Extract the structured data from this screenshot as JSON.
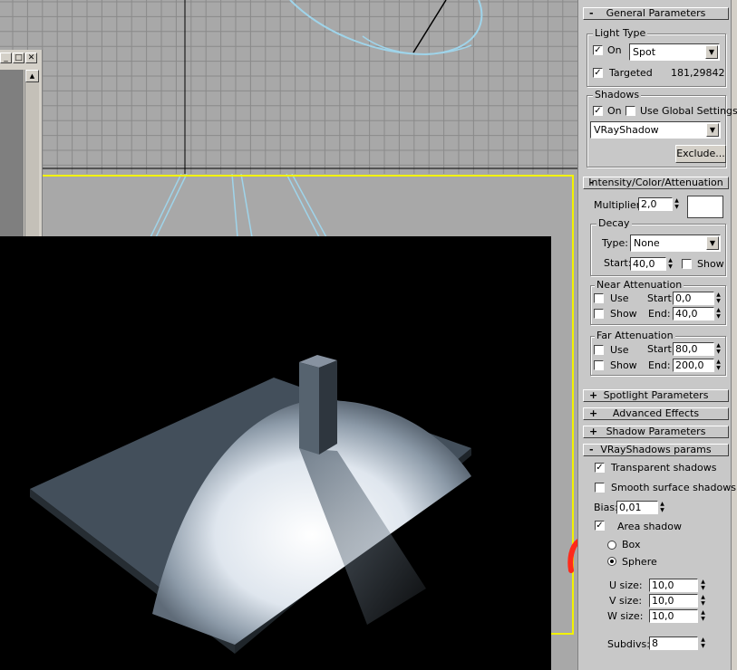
{
  "general": {
    "title": "General Parameters",
    "light_type_group": "Light Type",
    "on_label": "On",
    "on_checked": true,
    "type_value": "Spot",
    "targeted_label": "Targeted",
    "targeted_checked": true,
    "target_distance": "181,29842",
    "shadows_group": "Shadows",
    "shadows_on_label": "On",
    "use_global_label": "Use Global Settings",
    "shadow_type_value": "VRayShadow",
    "exclude_label": "Exclude..."
  },
  "intensity": {
    "title": "Intensity/Color/Attenuation",
    "multiplier_label": "Multiplier:",
    "multiplier_value": "2,0",
    "color": "#ffffff",
    "decay_group": "Decay",
    "type_label": "Type:",
    "type_value": "None",
    "start_label": "Start:",
    "start_value": "40,0",
    "show_label": "Show",
    "near_group": "Near Attenuation",
    "near_use": "Use",
    "near_show": "Show",
    "near_start_label": "Start:",
    "near_start_value": "0,0",
    "near_end_label": "End:",
    "near_end_value": "40,0",
    "far_group": "Far Attenuation",
    "far_use": "Use",
    "far_show": "Show",
    "far_start_label": "Start:",
    "far_start_value": "80,0",
    "far_end_label": "End:",
    "far_end_value": "200,0"
  },
  "collapsed": [
    {
      "sign": "+",
      "title": "Spotlight Parameters"
    },
    {
      "sign": "+",
      "title": "Advanced Effects"
    },
    {
      "sign": "+",
      "title": "Shadow Parameters"
    }
  ],
  "vray": {
    "title": "VRayShadows params",
    "transparent_label": "Transparent shadows",
    "smooth_label": "Smooth surface shadows",
    "bias_label": "Bias:",
    "bias_value": "0,01",
    "area_label": "Area shadow",
    "box_label": "Box",
    "sphere_label": "Sphere",
    "u_label": "U size:",
    "u_value": "10,0",
    "v_label": "V size:",
    "v_value": "10,0",
    "w_label": "W size:",
    "w_value": "10,0",
    "subdivs_label": "Subdivs:",
    "subdivs_value": "8"
  },
  "colors": {
    "viewport_active_border": "#f2f200",
    "annotation_arrow": "#ff2a1a",
    "render_bg": "#000000"
  }
}
